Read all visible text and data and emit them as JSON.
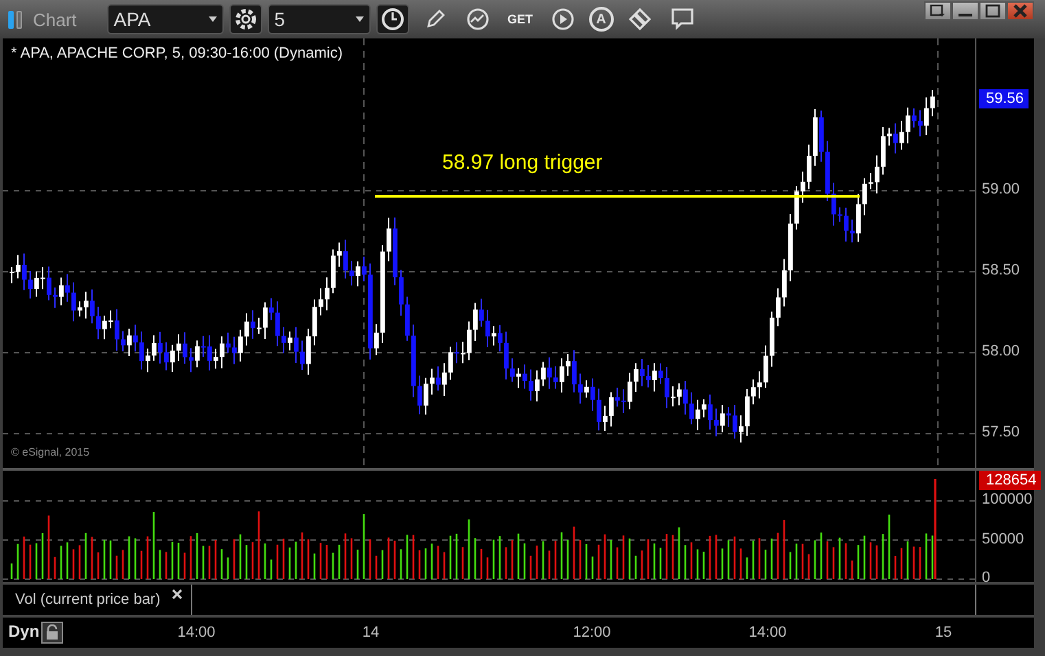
{
  "window": {
    "title": "Chart"
  },
  "toolbar": {
    "symbol": "APA",
    "interval": "5",
    "get_label": "GET",
    "alert_label": "A"
  },
  "chart": {
    "header": "* APA, APACHE CORP, 5, 09:30-16:00 (Dynamic)",
    "annotation": "58.97 long trigger",
    "copyright": "© eSignal, 2015",
    "price_ticks": [
      "59.00",
      "58.50",
      "58.00",
      "57.50"
    ],
    "last_price": "59.56"
  },
  "volume": {
    "ticks": [
      "100000",
      "50000",
      "0"
    ],
    "last_volume": "128654",
    "legend": "Vol (current price bar)"
  },
  "time_axis": {
    "mode": "Dyn",
    "labels": [
      "14:00",
      "14",
      "12:00",
      "14:00",
      "15"
    ]
  }
}
